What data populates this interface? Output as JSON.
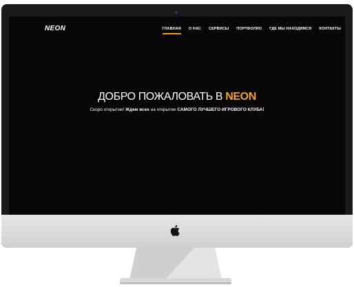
{
  "site": {
    "logo": "NEON",
    "menu": [
      {
        "label": "ГЛАВНАЯ",
        "active": true
      },
      {
        "label": "О НАС",
        "active": false
      },
      {
        "label": "СЕРВИСЫ",
        "active": false
      },
      {
        "label": "ПОРТФОЛИО",
        "active": false
      },
      {
        "label": "ГДЕ МЫ НАХОДИМСЯ",
        "active": false
      },
      {
        "label": "КОНТАКТЫ",
        "active": false
      }
    ],
    "hero": {
      "title_prefix": "ДОБРО ПОЖАЛОВАТЬ В ",
      "title_brand": "NEON",
      "sub_part1": "Скоро открытие! ",
      "sub_bold1": "Ждем всех",
      "sub_part2": "  на  открытие ",
      "sub_bold2": "САМОГО ЛУЧШЕГО ИГРОВОГО КЛУБА!"
    }
  },
  "icons": {
    "device": "apple-icon"
  },
  "colors": {
    "accent": "#f5a623",
    "screen_bg": "#060606",
    "bezel": "#1a1a1a"
  }
}
